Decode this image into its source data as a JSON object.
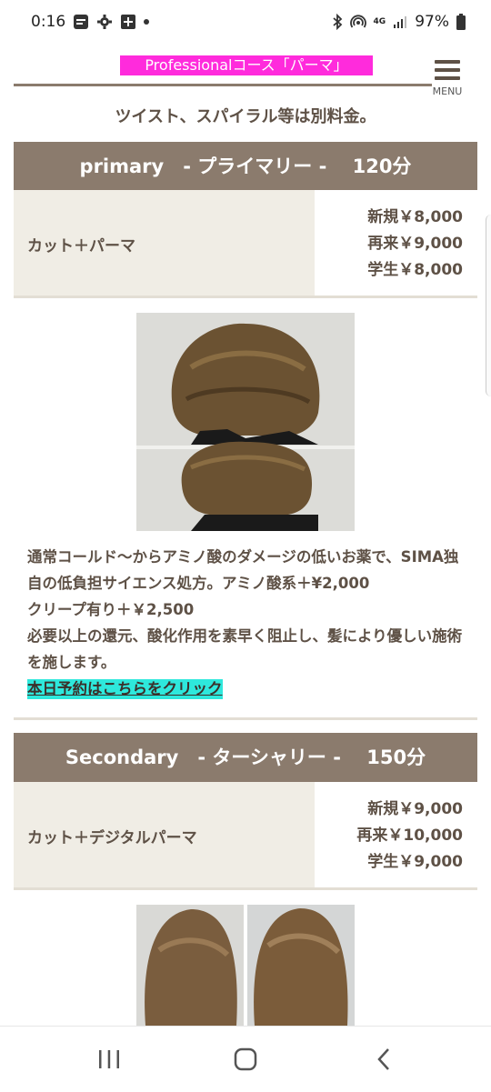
{
  "status_bar": {
    "time": "0:16",
    "signal_label": "4G",
    "battery_percent": "97%"
  },
  "header": {
    "title": "Professionalコース「パーマ」",
    "menu_label": "MENU"
  },
  "note": "ツイスト、スパイラル等は別料金。",
  "courses": [
    {
      "band_label": "primary　- プライマリー -　 120分",
      "menu_name": "カット＋パーマ",
      "prices": [
        "新規￥8,000",
        "再来￥9,000",
        "学生￥8,000"
      ]
    },
    {
      "band_label": "Secondary　- ターシャリー -　 150分",
      "menu_name": "カット＋デジタルパーマ",
      "prices": [
        "新規￥9,000",
        "再来￥10,000",
        "学生￥9,000"
      ]
    }
  ],
  "description": {
    "line1": "通常コールド〜からアミノ酸のダメージの低いお薬で、SIMA独自の低負担サイエンス処方。アミノ酸系＋¥2,000",
    "line2": "クリープ有り＋￥2,500",
    "line3": "必要以上の還元、酸化作用を素早く阻止し、髪により優しい施術を施します。",
    "link_text": "本日予約はこちらをクリック"
  },
  "colors": {
    "band": "#8b7b6d",
    "text": "#5e5146",
    "title_highlight": "#ff2bdc",
    "link_highlight": "#2ee8dc",
    "table_left": "#f0ede5"
  }
}
